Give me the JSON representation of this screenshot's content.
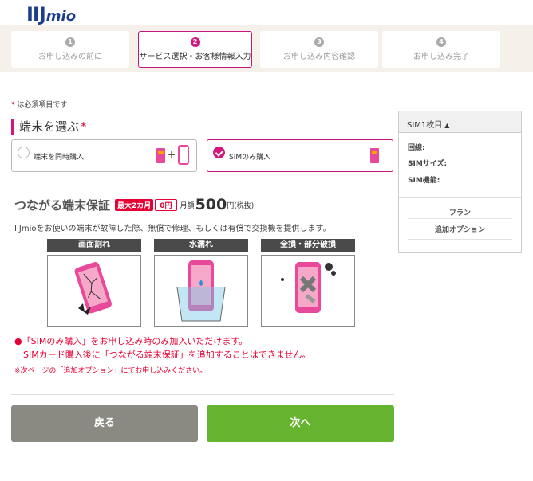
{
  "logo": {
    "part1": "IIJ",
    "part2": "mio"
  },
  "steps": [
    {
      "num": "1",
      "label": "お申し込みの前に"
    },
    {
      "num": "2",
      "label": "サービス選択・お客様情報入力"
    },
    {
      "num": "3",
      "label": "お申し込み内容確認"
    },
    {
      "num": "4",
      "label": "お申し込み完了"
    }
  ],
  "required_note": {
    "asterisk": "*",
    "text": " は必須項目です"
  },
  "device_section": {
    "title": "端末を選ぶ",
    "asterisk": "*"
  },
  "options": [
    {
      "label": "端末を同時購入",
      "selected": false
    },
    {
      "label": "SIMのみ購入",
      "selected": true
    }
  ],
  "warranty": {
    "title": "つながる端末保証",
    "badge_months": "最大2カ月",
    "badge_price": "0円",
    "monthly_prefix": "月額",
    "price": "500",
    "price_suffix": "円(税抜)",
    "description": "IIJmioをお使いの端末が故障した際、無償で修理、もしくは有償で交換機を提供します。",
    "cases": [
      "画面割れ",
      "水濡れ",
      "全損・部分破損"
    ]
  },
  "notice": {
    "line1": "●「SIMのみ購入」をお申し込み時のみ加入いただけます。",
    "line2": "　SIMカード購入後に「つながる端末保証」を追加することはできません。",
    "line3": "※次ページの「追加オプション」にてお申し込みください。"
  },
  "buttons": {
    "back": "戻る",
    "next": "次へ"
  },
  "sidebar": {
    "header": "SIM1枚目",
    "line": "回線:",
    "sim_size": "SIMサイズ:",
    "sim_function": "SIM機能:",
    "plan": "プラン",
    "options": "追加オプション"
  },
  "colors": {
    "accent": "#d3177f",
    "next": "#65b32e",
    "back": "#8a8a82",
    "warning": "#e60033",
    "brand": "#1d3e8f"
  }
}
